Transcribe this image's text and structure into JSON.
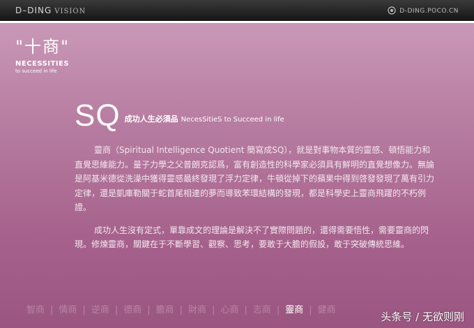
{
  "header": {
    "brand": "D–DING",
    "brand_sub": "VISION",
    "site": "D-DING.POCO.CN",
    "site_icon": "camera-lens-icon"
  },
  "logo": {
    "chinese": "\"十商\"",
    "english_title": "NECESSITIES",
    "english_sub": "to succeed in life"
  },
  "article": {
    "title": "SQ",
    "tagline_zh": "成功人生必須品",
    "tagline_en": "NecesSitieS to Succeed in life",
    "paragraphs": [
      "靈商（Spiritual Intelligence Quotient 簡寫成SQ），就是對事物本質的靈感、頓悟能力和直覺思維能力。量子力學之父普朗克認爲，富有創造性的科學家必須具有鮮明的直覺想像力。無論是阿基米德從洗澡中獲得靈感最終發現了浮力定律，牛頓從掉下的蘋果中得到啓發發現了萬有引力定律，還是凱庫勒關于蛇首尾相連的夢而導致苯環結構的發現，都是科學史上靈商飛躍的不朽例證。",
      "成功人生沒有定式，單靠成文的理論是解決不了實際問題的，還得需要悟性，需要靈商的閃現。修煉靈商，關鍵在于不斷學習、觀察、思考，要敢于大膽的假設，敢于突破傳統思維。"
    ]
  },
  "footer_nav": [
    "智商",
    "情商",
    "逆商",
    "德商",
    "膽商",
    "財商",
    "心商",
    "志商",
    "靈商",
    "健商"
  ],
  "footer_active": 8,
  "watermark": "头条号 / 无欲则刚",
  "colors": {
    "topbar": "#1f1f1f",
    "panel_top": "#c998b7",
    "panel_bottom": "#9a5580",
    "text": "#ffffff"
  }
}
